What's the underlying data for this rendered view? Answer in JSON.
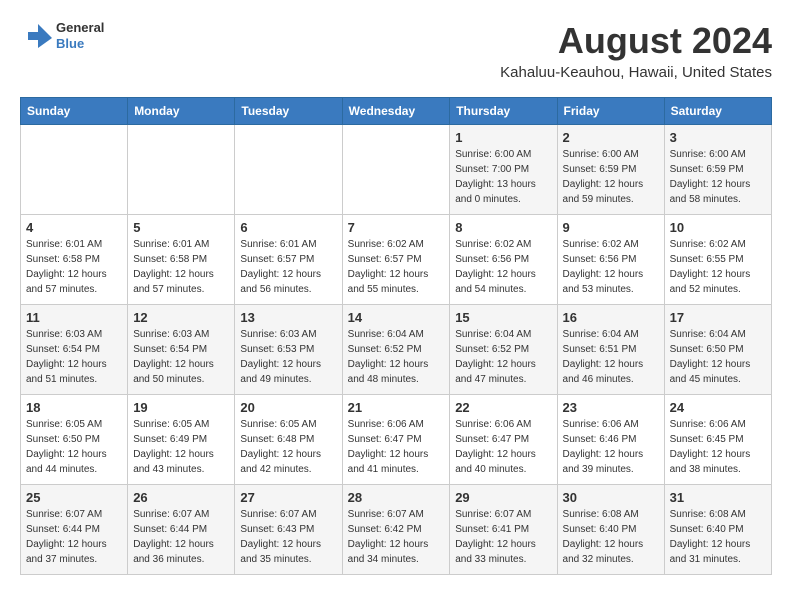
{
  "header": {
    "logo_line1": "General",
    "logo_line2": "Blue",
    "month": "August 2024",
    "location": "Kahaluu-Keauhou, Hawaii, United States"
  },
  "days_of_week": [
    "Sunday",
    "Monday",
    "Tuesday",
    "Wednesday",
    "Thursday",
    "Friday",
    "Saturday"
  ],
  "weeks": [
    [
      {
        "day": "",
        "info": ""
      },
      {
        "day": "",
        "info": ""
      },
      {
        "day": "",
        "info": ""
      },
      {
        "day": "",
        "info": ""
      },
      {
        "day": "1",
        "info": "Sunrise: 6:00 AM\nSunset: 7:00 PM\nDaylight: 13 hours\nand 0 minutes."
      },
      {
        "day": "2",
        "info": "Sunrise: 6:00 AM\nSunset: 6:59 PM\nDaylight: 12 hours\nand 59 minutes."
      },
      {
        "day": "3",
        "info": "Sunrise: 6:00 AM\nSunset: 6:59 PM\nDaylight: 12 hours\nand 58 minutes."
      }
    ],
    [
      {
        "day": "4",
        "info": "Sunrise: 6:01 AM\nSunset: 6:58 PM\nDaylight: 12 hours\nand 57 minutes."
      },
      {
        "day": "5",
        "info": "Sunrise: 6:01 AM\nSunset: 6:58 PM\nDaylight: 12 hours\nand 57 minutes."
      },
      {
        "day": "6",
        "info": "Sunrise: 6:01 AM\nSunset: 6:57 PM\nDaylight: 12 hours\nand 56 minutes."
      },
      {
        "day": "7",
        "info": "Sunrise: 6:02 AM\nSunset: 6:57 PM\nDaylight: 12 hours\nand 55 minutes."
      },
      {
        "day": "8",
        "info": "Sunrise: 6:02 AM\nSunset: 6:56 PM\nDaylight: 12 hours\nand 54 minutes."
      },
      {
        "day": "9",
        "info": "Sunrise: 6:02 AM\nSunset: 6:56 PM\nDaylight: 12 hours\nand 53 minutes."
      },
      {
        "day": "10",
        "info": "Sunrise: 6:02 AM\nSunset: 6:55 PM\nDaylight: 12 hours\nand 52 minutes."
      }
    ],
    [
      {
        "day": "11",
        "info": "Sunrise: 6:03 AM\nSunset: 6:54 PM\nDaylight: 12 hours\nand 51 minutes."
      },
      {
        "day": "12",
        "info": "Sunrise: 6:03 AM\nSunset: 6:54 PM\nDaylight: 12 hours\nand 50 minutes."
      },
      {
        "day": "13",
        "info": "Sunrise: 6:03 AM\nSunset: 6:53 PM\nDaylight: 12 hours\nand 49 minutes."
      },
      {
        "day": "14",
        "info": "Sunrise: 6:04 AM\nSunset: 6:52 PM\nDaylight: 12 hours\nand 48 minutes."
      },
      {
        "day": "15",
        "info": "Sunrise: 6:04 AM\nSunset: 6:52 PM\nDaylight: 12 hours\nand 47 minutes."
      },
      {
        "day": "16",
        "info": "Sunrise: 6:04 AM\nSunset: 6:51 PM\nDaylight: 12 hours\nand 46 minutes."
      },
      {
        "day": "17",
        "info": "Sunrise: 6:04 AM\nSunset: 6:50 PM\nDaylight: 12 hours\nand 45 minutes."
      }
    ],
    [
      {
        "day": "18",
        "info": "Sunrise: 6:05 AM\nSunset: 6:50 PM\nDaylight: 12 hours\nand 44 minutes."
      },
      {
        "day": "19",
        "info": "Sunrise: 6:05 AM\nSunset: 6:49 PM\nDaylight: 12 hours\nand 43 minutes."
      },
      {
        "day": "20",
        "info": "Sunrise: 6:05 AM\nSunset: 6:48 PM\nDaylight: 12 hours\nand 42 minutes."
      },
      {
        "day": "21",
        "info": "Sunrise: 6:06 AM\nSunset: 6:47 PM\nDaylight: 12 hours\nand 41 minutes."
      },
      {
        "day": "22",
        "info": "Sunrise: 6:06 AM\nSunset: 6:47 PM\nDaylight: 12 hours\nand 40 minutes."
      },
      {
        "day": "23",
        "info": "Sunrise: 6:06 AM\nSunset: 6:46 PM\nDaylight: 12 hours\nand 39 minutes."
      },
      {
        "day": "24",
        "info": "Sunrise: 6:06 AM\nSunset: 6:45 PM\nDaylight: 12 hours\nand 38 minutes."
      }
    ],
    [
      {
        "day": "25",
        "info": "Sunrise: 6:07 AM\nSunset: 6:44 PM\nDaylight: 12 hours\nand 37 minutes."
      },
      {
        "day": "26",
        "info": "Sunrise: 6:07 AM\nSunset: 6:44 PM\nDaylight: 12 hours\nand 36 minutes."
      },
      {
        "day": "27",
        "info": "Sunrise: 6:07 AM\nSunset: 6:43 PM\nDaylight: 12 hours\nand 35 minutes."
      },
      {
        "day": "28",
        "info": "Sunrise: 6:07 AM\nSunset: 6:42 PM\nDaylight: 12 hours\nand 34 minutes."
      },
      {
        "day": "29",
        "info": "Sunrise: 6:07 AM\nSunset: 6:41 PM\nDaylight: 12 hours\nand 33 minutes."
      },
      {
        "day": "30",
        "info": "Sunrise: 6:08 AM\nSunset: 6:40 PM\nDaylight: 12 hours\nand 32 minutes."
      },
      {
        "day": "31",
        "info": "Sunrise: 6:08 AM\nSunset: 6:40 PM\nDaylight: 12 hours\nand 31 minutes."
      }
    ]
  ]
}
